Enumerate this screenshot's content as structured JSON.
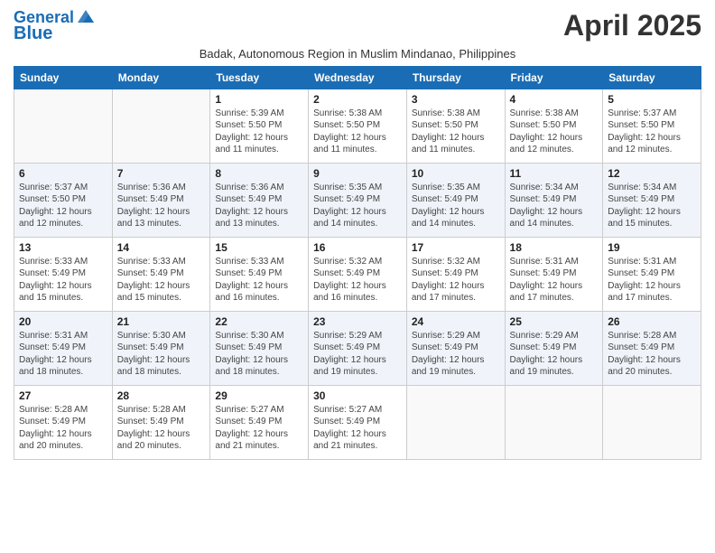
{
  "logo": {
    "line1": "General",
    "line2": "Blue"
  },
  "title": "April 2025",
  "subtitle": "Badak, Autonomous Region in Muslim Mindanao, Philippines",
  "days_of_week": [
    "Sunday",
    "Monday",
    "Tuesday",
    "Wednesday",
    "Thursday",
    "Friday",
    "Saturday"
  ],
  "weeks": [
    [
      {
        "day": "",
        "info": ""
      },
      {
        "day": "",
        "info": ""
      },
      {
        "day": "1",
        "info": "Sunrise: 5:39 AM\nSunset: 5:50 PM\nDaylight: 12 hours and 11 minutes."
      },
      {
        "day": "2",
        "info": "Sunrise: 5:38 AM\nSunset: 5:50 PM\nDaylight: 12 hours and 11 minutes."
      },
      {
        "day": "3",
        "info": "Sunrise: 5:38 AM\nSunset: 5:50 PM\nDaylight: 12 hours and 11 minutes."
      },
      {
        "day": "4",
        "info": "Sunrise: 5:38 AM\nSunset: 5:50 PM\nDaylight: 12 hours and 12 minutes."
      },
      {
        "day": "5",
        "info": "Sunrise: 5:37 AM\nSunset: 5:50 PM\nDaylight: 12 hours and 12 minutes."
      }
    ],
    [
      {
        "day": "6",
        "info": "Sunrise: 5:37 AM\nSunset: 5:50 PM\nDaylight: 12 hours and 12 minutes."
      },
      {
        "day": "7",
        "info": "Sunrise: 5:36 AM\nSunset: 5:49 PM\nDaylight: 12 hours and 13 minutes."
      },
      {
        "day": "8",
        "info": "Sunrise: 5:36 AM\nSunset: 5:49 PM\nDaylight: 12 hours and 13 minutes."
      },
      {
        "day": "9",
        "info": "Sunrise: 5:35 AM\nSunset: 5:49 PM\nDaylight: 12 hours and 14 minutes."
      },
      {
        "day": "10",
        "info": "Sunrise: 5:35 AM\nSunset: 5:49 PM\nDaylight: 12 hours and 14 minutes."
      },
      {
        "day": "11",
        "info": "Sunrise: 5:34 AM\nSunset: 5:49 PM\nDaylight: 12 hours and 14 minutes."
      },
      {
        "day": "12",
        "info": "Sunrise: 5:34 AM\nSunset: 5:49 PM\nDaylight: 12 hours and 15 minutes."
      }
    ],
    [
      {
        "day": "13",
        "info": "Sunrise: 5:33 AM\nSunset: 5:49 PM\nDaylight: 12 hours and 15 minutes."
      },
      {
        "day": "14",
        "info": "Sunrise: 5:33 AM\nSunset: 5:49 PM\nDaylight: 12 hours and 15 minutes."
      },
      {
        "day": "15",
        "info": "Sunrise: 5:33 AM\nSunset: 5:49 PM\nDaylight: 12 hours and 16 minutes."
      },
      {
        "day": "16",
        "info": "Sunrise: 5:32 AM\nSunset: 5:49 PM\nDaylight: 12 hours and 16 minutes."
      },
      {
        "day": "17",
        "info": "Sunrise: 5:32 AM\nSunset: 5:49 PM\nDaylight: 12 hours and 17 minutes."
      },
      {
        "day": "18",
        "info": "Sunrise: 5:31 AM\nSunset: 5:49 PM\nDaylight: 12 hours and 17 minutes."
      },
      {
        "day": "19",
        "info": "Sunrise: 5:31 AM\nSunset: 5:49 PM\nDaylight: 12 hours and 17 minutes."
      }
    ],
    [
      {
        "day": "20",
        "info": "Sunrise: 5:31 AM\nSunset: 5:49 PM\nDaylight: 12 hours and 18 minutes."
      },
      {
        "day": "21",
        "info": "Sunrise: 5:30 AM\nSunset: 5:49 PM\nDaylight: 12 hours and 18 minutes."
      },
      {
        "day": "22",
        "info": "Sunrise: 5:30 AM\nSunset: 5:49 PM\nDaylight: 12 hours and 18 minutes."
      },
      {
        "day": "23",
        "info": "Sunrise: 5:29 AM\nSunset: 5:49 PM\nDaylight: 12 hours and 19 minutes."
      },
      {
        "day": "24",
        "info": "Sunrise: 5:29 AM\nSunset: 5:49 PM\nDaylight: 12 hours and 19 minutes."
      },
      {
        "day": "25",
        "info": "Sunrise: 5:29 AM\nSunset: 5:49 PM\nDaylight: 12 hours and 19 minutes."
      },
      {
        "day": "26",
        "info": "Sunrise: 5:28 AM\nSunset: 5:49 PM\nDaylight: 12 hours and 20 minutes."
      }
    ],
    [
      {
        "day": "27",
        "info": "Sunrise: 5:28 AM\nSunset: 5:49 PM\nDaylight: 12 hours and 20 minutes."
      },
      {
        "day": "28",
        "info": "Sunrise: 5:28 AM\nSunset: 5:49 PM\nDaylight: 12 hours and 20 minutes."
      },
      {
        "day": "29",
        "info": "Sunrise: 5:27 AM\nSunset: 5:49 PM\nDaylight: 12 hours and 21 minutes."
      },
      {
        "day": "30",
        "info": "Sunrise: 5:27 AM\nSunset: 5:49 PM\nDaylight: 12 hours and 21 minutes."
      },
      {
        "day": "",
        "info": ""
      },
      {
        "day": "",
        "info": ""
      },
      {
        "day": "",
        "info": ""
      }
    ]
  ]
}
